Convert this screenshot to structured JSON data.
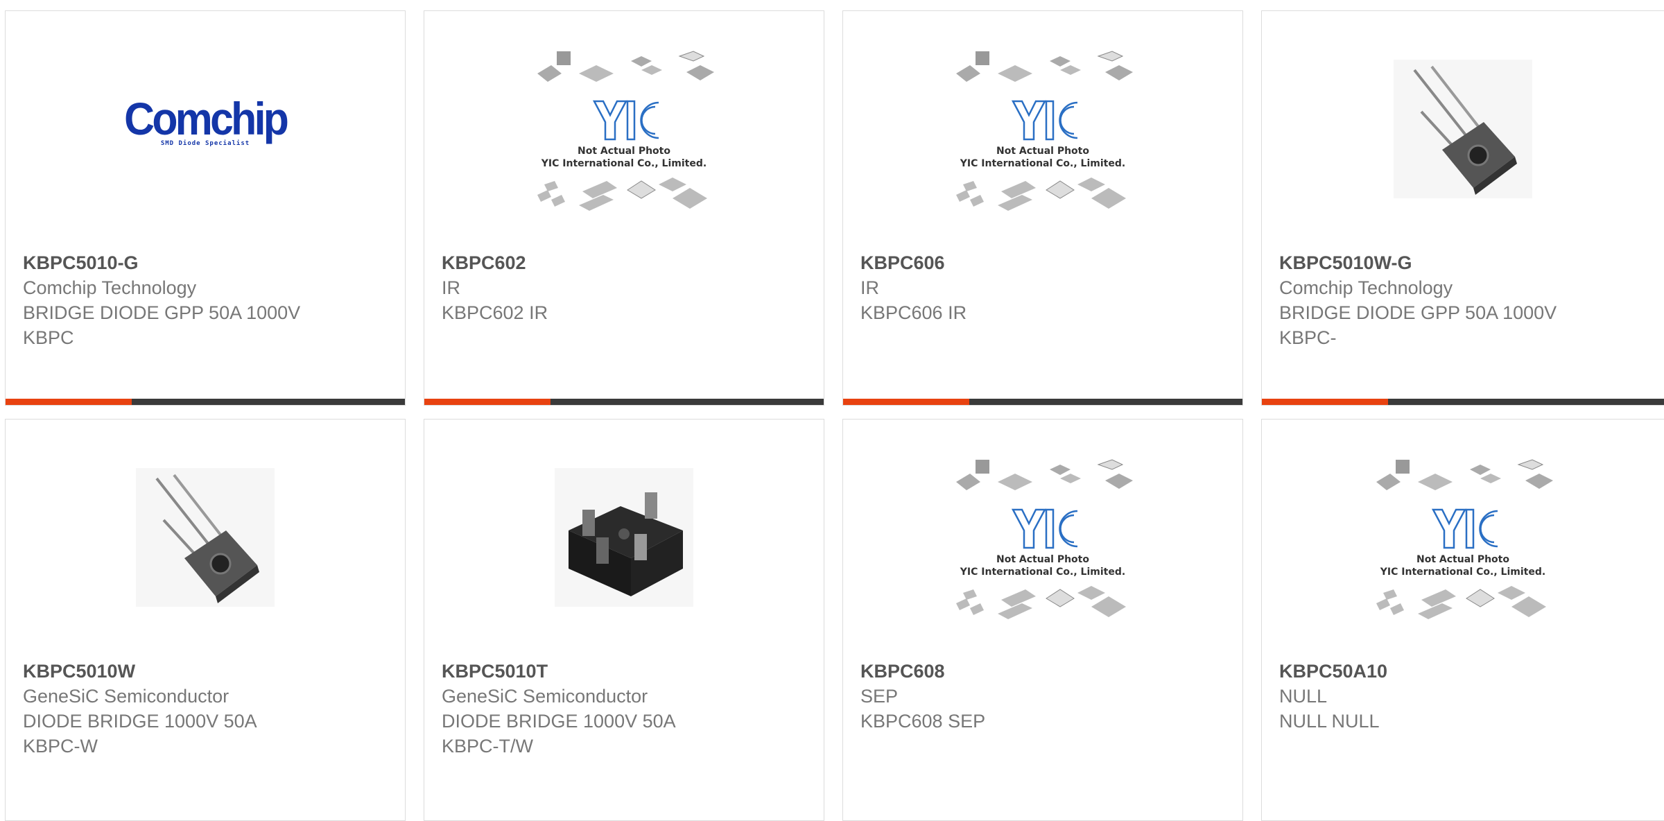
{
  "cards": [
    {
      "part": "KBPC5010-G",
      "maker": "Comchip Technology",
      "desc": "BRIDGE DIODE GPP 50A 1000V",
      "extra": "KBPC",
      "image": "comchip-logo"
    },
    {
      "part": "KBPC602",
      "maker": "IR",
      "desc": "KBPC602 IR",
      "extra": "",
      "image": "yic-placeholder"
    },
    {
      "part": "KBPC606",
      "maker": "IR",
      "desc": "KBPC606 IR",
      "extra": "",
      "image": "yic-placeholder"
    },
    {
      "part": "KBPC5010W-G",
      "maker": "Comchip Technology",
      "desc": "BRIDGE DIODE GPP 50A 1000V",
      "extra": "KBPC-",
      "image": "wire-lead-bridge"
    },
    {
      "part": "KBPC5010W",
      "maker": "GeneSiC Semiconductor",
      "desc": "DIODE BRIDGE 1000V 50A",
      "extra": "KBPC-W",
      "image": "wire-lead-bridge"
    },
    {
      "part": "KBPC5010T",
      "maker": "GeneSiC Semiconductor",
      "desc": "DIODE BRIDGE 1000V 50A",
      "extra": "KBPC-T/W",
      "image": "tab-bridge"
    },
    {
      "part": "KBPC608",
      "maker": "SEP",
      "desc": "KBPC608 SEP",
      "extra": "",
      "image": "yic-placeholder"
    },
    {
      "part": "KBPC50A10",
      "maker": "NULL",
      "desc": "NULL NULL",
      "extra": "",
      "image": "yic-placeholder"
    }
  ],
  "comchip": {
    "word": "Comchip",
    "tagline": "SMD Diode Specialist"
  },
  "yic": {
    "line1": "Not Actual Photo",
    "line2": "YIC International Co., Limited."
  },
  "colors": {
    "accent": "#e84210",
    "bar": "#3a3a3a",
    "brand_blue": "#1436a8"
  }
}
